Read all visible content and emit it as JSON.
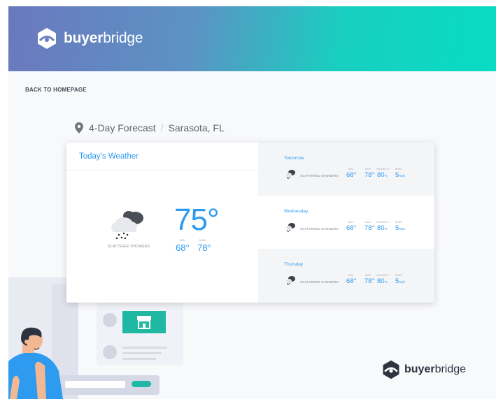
{
  "header": {
    "brand_bold": "buyer",
    "brand_light": "bridge"
  },
  "nav": {
    "back_label": "BACK TO HOMEPAGE"
  },
  "location": {
    "title": "4-Day Forecast",
    "separator": "/",
    "city": "Sarasota, FL"
  },
  "today": {
    "title": "Today's Weather",
    "condition": "SCATTERED SHOWERS",
    "temp": "75°",
    "min_label": "MIN",
    "max_label": "MAX",
    "min": "68°",
    "max": "78°",
    "icon": "scattered-showers-icon"
  },
  "labels": {
    "min": "MIN",
    "max": "MAX",
    "humidity": "HUMIDITY",
    "wind": "WIND",
    "humidity_unit": "%",
    "wind_unit": "mph"
  },
  "forecast": [
    {
      "day": "Tomorrow",
      "condition": "SCATTERED SHOWERS",
      "min": "68°",
      "max": "78°",
      "humidity": "80",
      "wind": "5"
    },
    {
      "day": "Wednesday",
      "condition": "SCATTERED SHOWERS",
      "min": "68°",
      "max": "78°",
      "humidity": "80",
      "wind": "5"
    },
    {
      "day": "Thursday",
      "condition": "SCATTERED SHOWERS",
      "min": "68°",
      "max": "78°",
      "humidity": "80",
      "wind": "5"
    }
  ],
  "footer": {
    "brand_bold": "buyer",
    "brand_light": "bridge"
  },
  "colors": {
    "accent": "#2f9bf0",
    "teal": "#1fb8a3",
    "header_start": "#6a78be",
    "header_end": "#08dcc2"
  }
}
